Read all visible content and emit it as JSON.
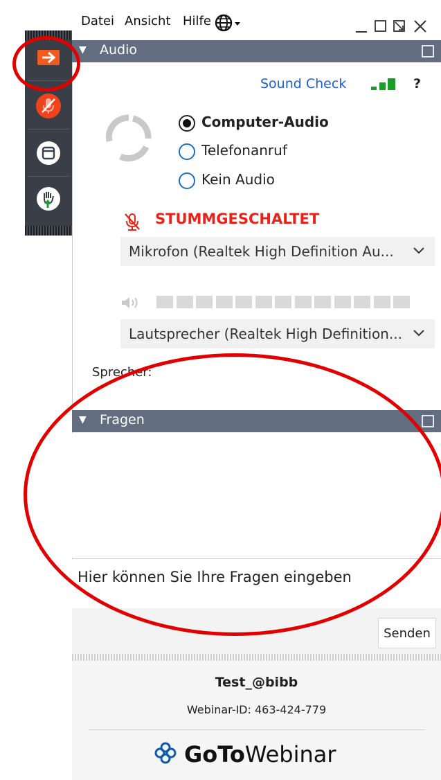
{
  "menu": {
    "items": [
      "Datei",
      "Ansicht",
      "Hilfe"
    ]
  },
  "audio": {
    "title": "Audio",
    "sound_check": "Sound Check",
    "help": "?",
    "options": [
      "Computer-Audio",
      "Telefonanruf",
      "Kein Audio"
    ],
    "selected": 0,
    "mute_status": "STUMMGESCHALTET",
    "microphone": "Mikrofon (Realtek High Definition Au...",
    "speaker": "Lautsprecher (Realtek High Definition...",
    "speaker_label": "Sprecher:"
  },
  "questions": {
    "title": "Fragen",
    "placeholder": "Hier können Sie Ihre Fragen eingeben",
    "send": "Senden"
  },
  "webinar": {
    "name": "Test_@bibb",
    "id_text": "Webinar-ID: 463-424-779",
    "brand_bold": "GoTo",
    "brand_light": "Webinar"
  },
  "colors": {
    "accent_orange": "#f25a1f",
    "mute_red": "#e8231a",
    "link_blue": "#1a5fd6",
    "signal_green": "#1a9e2a",
    "header_slate": "#626d80",
    "annotation_red": "#e00000"
  },
  "icons": {
    "toolbar": [
      "arrow-right-icon",
      "mic-muted-icon",
      "window-icon",
      "raise-hand-icon"
    ],
    "menu": "globe-icon",
    "window": [
      "minimize-icon",
      "maximize-icon",
      "popout-icon",
      "close-icon"
    ]
  }
}
